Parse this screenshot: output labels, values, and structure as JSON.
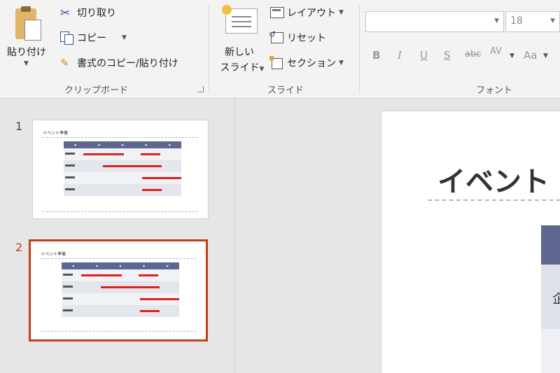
{
  "ribbon": {
    "clipboard": {
      "paste_label": "貼り付け",
      "cut_label": "切り取り",
      "copy_label": "コピー",
      "format_painter_label": "書式のコピー/貼り付け",
      "group_label": "クリップボード"
    },
    "slides": {
      "new_slide_label_line1": "新しい",
      "new_slide_label_line2": "スライド",
      "layout_label": "レイアウト",
      "reset_label": "リセット",
      "section_label": "セクション",
      "group_label": "スライド"
    },
    "font": {
      "font_name": "",
      "font_size": "18",
      "bold": "B",
      "italic": "I",
      "underline": "U",
      "shadow": "S",
      "strikethrough": "abc",
      "spacing": "AV",
      "change_case": "Aa",
      "group_label": "フォント"
    }
  },
  "thumbnails": [
    {
      "number": "1",
      "title": "イベント準備",
      "selected": false
    },
    {
      "number": "2",
      "title": "イベント準備",
      "selected": true
    }
  ],
  "main_slide": {
    "title": "イベント",
    "cell_text": "企"
  },
  "colors": {
    "selection_border": "#c43e1c",
    "table_header": "#5f6690",
    "bar_red": "#e02020"
  }
}
